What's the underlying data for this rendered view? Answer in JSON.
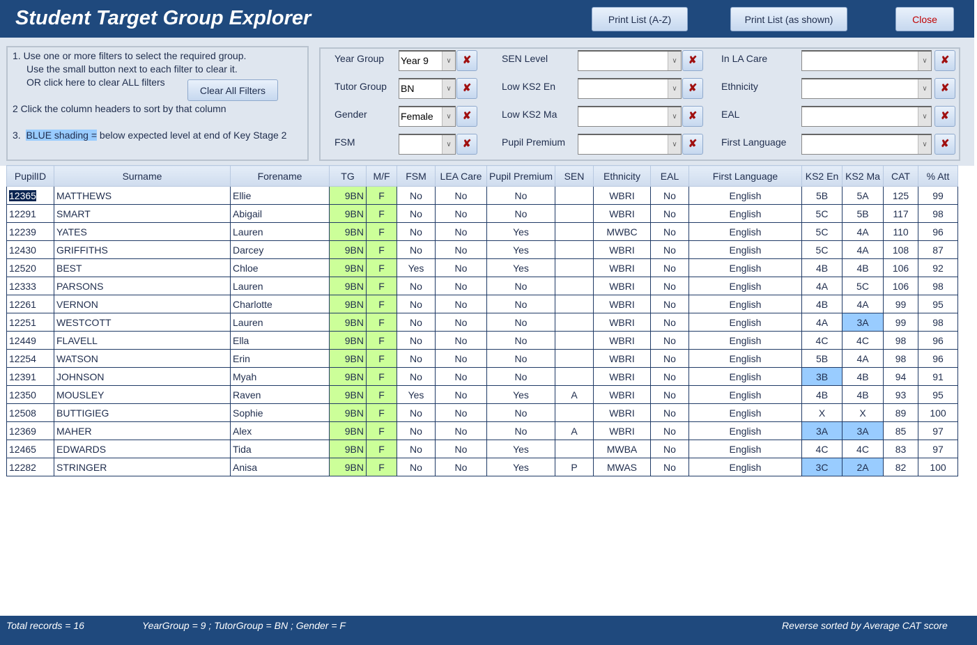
{
  "header": {
    "title": "Student Target Group Explorer",
    "print_az": "Print List (A-Z)",
    "print_shown": "Print List (as shown)",
    "close": "Close"
  },
  "instructions": {
    "line1": "1.  Use one or more filters to select the required group.",
    "line2": "Use the small button next to each filter to clear it.",
    "line3": "OR click here to clear ALL filters",
    "clear_all": "Clear All Filters",
    "line4": "2   Click the column headers to sort by that column",
    "line5_num": "3.",
    "line5_hl": "BLUE shading =",
    "line5_rest": " below expected level at end of Key Stage 2"
  },
  "filters": [
    {
      "label": "Year Group",
      "value": "Year 9"
    },
    {
      "label": "Tutor Group",
      "value": "BN"
    },
    {
      "label": "Gender",
      "value": "Female"
    },
    {
      "label": "FSM",
      "value": ""
    },
    {
      "label": "SEN Level",
      "value": ""
    },
    {
      "label": "Low KS2 En",
      "value": ""
    },
    {
      "label": "Low KS2 Ma",
      "value": ""
    },
    {
      "label": "Pupil Premium",
      "value": ""
    },
    {
      "label": "In LA Care",
      "value": ""
    },
    {
      "label": "Ethnicity",
      "value": ""
    },
    {
      "label": "EAL",
      "value": ""
    },
    {
      "label": "First Language",
      "value": ""
    }
  ],
  "table": {
    "columns": [
      "PupilID",
      "Surname",
      "Forename",
      "TG",
      "M/F",
      "FSM",
      "LEA Care",
      "Pupil Premium",
      "SEN",
      "Ethnicity",
      "EAL",
      "First Language",
      "KS2 En",
      "KS2 Ma",
      "CAT",
      "% Att"
    ],
    "rows": [
      {
        "cells": [
          "12365",
          "MATTHEWS",
          "Ellie",
          "9BN",
          "F",
          "No",
          "No",
          "No",
          "",
          "WBRI",
          "No",
          "English",
          "5B",
          "5A",
          "125",
          "99"
        ],
        "low_en": false,
        "low_ma": false
      },
      {
        "cells": [
          "12291",
          "SMART",
          "Abigail",
          "9BN",
          "F",
          "No",
          "No",
          "No",
          "",
          "WBRI",
          "No",
          "English",
          "5C",
          "5B",
          "117",
          "98"
        ],
        "low_en": false,
        "low_ma": false
      },
      {
        "cells": [
          "12239",
          "YATES",
          "Lauren",
          "9BN",
          "F",
          "No",
          "No",
          "Yes",
          "",
          "MWBC",
          "No",
          "English",
          "5C",
          "4A",
          "110",
          "96"
        ],
        "low_en": false,
        "low_ma": false
      },
      {
        "cells": [
          "12430",
          "GRIFFITHS",
          "Darcey",
          "9BN",
          "F",
          "No",
          "No",
          "Yes",
          "",
          "WBRI",
          "No",
          "English",
          "5C",
          "4A",
          "108",
          "87"
        ],
        "low_en": false,
        "low_ma": false
      },
      {
        "cells": [
          "12520",
          "BEST",
          "Chloe",
          "9BN",
          "F",
          "Yes",
          "No",
          "Yes",
          "",
          "WBRI",
          "No",
          "English",
          "4B",
          "4B",
          "106",
          "92"
        ],
        "low_en": false,
        "low_ma": false
      },
      {
        "cells": [
          "12333",
          "PARSONS",
          "Lauren",
          "9BN",
          "F",
          "No",
          "No",
          "No",
          "",
          "WBRI",
          "No",
          "English",
          "4A",
          "5C",
          "106",
          "98"
        ],
        "low_en": false,
        "low_ma": false
      },
      {
        "cells": [
          "12261",
          "VERNON",
          "Charlotte",
          "9BN",
          "F",
          "No",
          "No",
          "No",
          "",
          "WBRI",
          "No",
          "English",
          "4B",
          "4A",
          "99",
          "95"
        ],
        "low_en": false,
        "low_ma": false
      },
      {
        "cells": [
          "12251",
          "WESTCOTT",
          "Lauren",
          "9BN",
          "F",
          "No",
          "No",
          "No",
          "",
          "WBRI",
          "No",
          "English",
          "4A",
          "3A",
          "99",
          "98"
        ],
        "low_en": false,
        "low_ma": true
      },
      {
        "cells": [
          "12449",
          "FLAVELL",
          "Ella",
          "9BN",
          "F",
          "No",
          "No",
          "No",
          "",
          "WBRI",
          "No",
          "English",
          "4C",
          "4C",
          "98",
          "96"
        ],
        "low_en": false,
        "low_ma": false
      },
      {
        "cells": [
          "12254",
          "WATSON",
          "Erin",
          "9BN",
          "F",
          "No",
          "No",
          "No",
          "",
          "WBRI",
          "No",
          "English",
          "5B",
          "4A",
          "98",
          "96"
        ],
        "low_en": false,
        "low_ma": false
      },
      {
        "cells": [
          "12391",
          "JOHNSON",
          "Myah",
          "9BN",
          "F",
          "No",
          "No",
          "No",
          "",
          "WBRI",
          "No",
          "English",
          "3B",
          "4B",
          "94",
          "91"
        ],
        "low_en": true,
        "low_ma": false
      },
      {
        "cells": [
          "12350",
          "MOUSLEY",
          "Raven",
          "9BN",
          "F",
          "Yes",
          "No",
          "Yes",
          "A",
          "WBRI",
          "No",
          "English",
          "4B",
          "4B",
          "93",
          "95"
        ],
        "low_en": false,
        "low_ma": false
      },
      {
        "cells": [
          "12508",
          "BUTTIGIEG",
          "Sophie",
          "9BN",
          "F",
          "No",
          "No",
          "No",
          "",
          "WBRI",
          "No",
          "English",
          "X",
          "X",
          "89",
          "100"
        ],
        "low_en": false,
        "low_ma": false
      },
      {
        "cells": [
          "12369",
          "MAHER",
          "Alex",
          "9BN",
          "F",
          "No",
          "No",
          "No",
          "A",
          "WBRI",
          "No",
          "English",
          "3A",
          "3A",
          "85",
          "97"
        ],
        "low_en": true,
        "low_ma": true
      },
      {
        "cells": [
          "12465",
          "EDWARDS",
          "Tida",
          "9BN",
          "F",
          "No",
          "No",
          "Yes",
          "",
          "MWBA",
          "No",
          "English",
          "4C",
          "4C",
          "83",
          "97"
        ],
        "low_en": false,
        "low_ma": false
      },
      {
        "cells": [
          "12282",
          "STRINGER",
          "Anisa",
          "9BN",
          "F",
          "No",
          "No",
          "Yes",
          "P",
          "MWAS",
          "No",
          "English",
          "3C",
          "2A",
          "82",
          "100"
        ],
        "low_en": true,
        "low_ma": true
      }
    ]
  },
  "footer": {
    "total": "Total records = 16",
    "filters": "YearGroup = 9 ; TutorGroup = BN ; Gender = F",
    "sort": "Reverse sorted by Average CAT score"
  },
  "colors": {
    "header": "#1f497d",
    "green": "#ccff99",
    "blue": "#99ccff"
  }
}
